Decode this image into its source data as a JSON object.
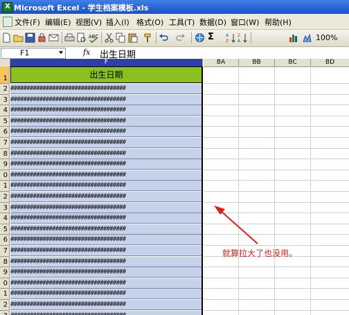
{
  "window": {
    "title": "Microsoft Excel - 学生档案模板.xls",
    "app_icon_letter": "X"
  },
  "menu": [
    {
      "label": "文件(F)"
    },
    {
      "label": "编辑(E)"
    },
    {
      "label": "视图(V)"
    },
    {
      "label": "插入(I)"
    },
    {
      "label": "格式(O)"
    },
    {
      "label": "工具(T)"
    },
    {
      "label": "数据(D)"
    },
    {
      "label": "窗口(W)"
    },
    {
      "label": "帮助(H)"
    }
  ],
  "toolbar": {
    "icons": [
      "new-icon",
      "open-icon",
      "save-icon",
      "permission-icon",
      "email-icon",
      "print-icon",
      "print-preview-icon",
      "spelling-icon",
      "cut-icon",
      "copy-icon",
      "paste-icon",
      "format-painter-icon",
      "undo-icon",
      "redo-icon",
      "hyperlink-icon",
      "autosum-icon",
      "sort-ascending-icon",
      "sort-descending-icon",
      "chart-wizard-icon",
      "drawing-icon"
    ],
    "sum_symbol": "Σ",
    "zoom": "100%"
  },
  "formula_bar": {
    "name_box": "F1",
    "fx_label": "fx",
    "content": "出生日期"
  },
  "grid": {
    "columns": [
      {
        "label": "F",
        "selected": true
      },
      {
        "label": "BA",
        "selected": false
      },
      {
        "label": "BB",
        "selected": false
      },
      {
        "label": "BC",
        "selected": false
      },
      {
        "label": "BD",
        "selected": false
      }
    ],
    "rows": [
      "1",
      "2",
      "3",
      "4",
      "5",
      "6",
      "7",
      "8",
      "9",
      "0",
      "1",
      "2",
      "3",
      "4",
      "5",
      "6",
      "7",
      "8",
      "9",
      "0",
      "1",
      "2",
      "3"
    ],
    "header_cell": "出生日期",
    "overflow_text": "####################################"
  },
  "annotation": {
    "text": "就算拉大了也没用。",
    "color": "#d62020"
  },
  "colors": {
    "header_fill": "#8bc11e",
    "selection_fill": "#c6d2ea",
    "title_bar": "#1b4fc4"
  }
}
